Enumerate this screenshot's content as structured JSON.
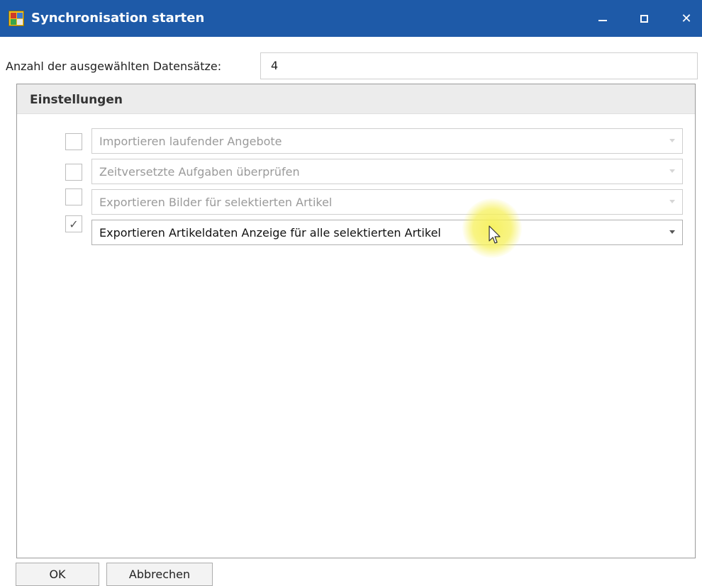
{
  "window": {
    "title": "Synchronisation starten",
    "icon": "app-icon",
    "controls": {
      "minimize": "minimize-icon",
      "maximize": "maximize-icon",
      "close": "✕"
    }
  },
  "record_count": {
    "label": "Anzahl der ausgewählten Datensätze:",
    "value": "4"
  },
  "settings": {
    "title": "Einstellungen",
    "options": [
      {
        "checked": false,
        "check_mark": "",
        "label": "Importieren laufender Angebote",
        "enabled": false
      },
      {
        "checked": false,
        "check_mark": "",
        "label": "Zeitversetzte Aufgaben überprüfen",
        "enabled": false
      },
      {
        "checked": false,
        "check_mark": "",
        "label": "Exportieren Bilder für selektierten Artikel",
        "enabled": false
      },
      {
        "checked": true,
        "check_mark": "✓",
        "label": "Exportieren Artikeldaten  Anzeige für alle selektierten Artikel",
        "enabled": true
      }
    ]
  },
  "buttons": {
    "ok": "OK",
    "cancel": "Abbrechen"
  },
  "colors": {
    "titlebar": "#1e5aa8",
    "cursor_highlight": "#f6f05a"
  }
}
